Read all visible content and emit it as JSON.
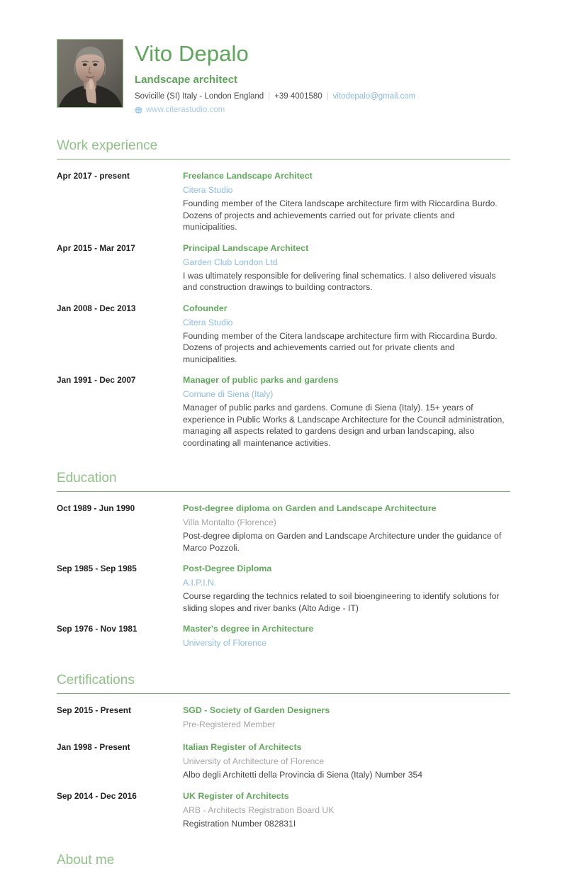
{
  "header": {
    "photo_alt": "profile-photo",
    "name": "Vito Depalo",
    "job_title": "Landscape architect",
    "location": "Sovicille (SI) Italy - London England",
    "phone": "+39 4001580",
    "email": "vitodepalo@gmail.com",
    "website": "www.citerastudio.com",
    "separator": "|",
    "colors": {
      "name_green": "#5da558",
      "heading_green": "#8fc287",
      "rule_green": "#74b06b",
      "link_blue": "#8cbbe8",
      "muted_gray": "#a6a6a6"
    }
  },
  "sections": [
    {
      "id": "work-experience",
      "title": "Work experience",
      "entries": [
        {
          "date": "Apr 2017 - present",
          "title": "Freelance Landscape Architect",
          "subtitle": "Citera Studio",
          "subtitle_style": "blue",
          "description": "Founding member of the Citera landscape architecture firm with Riccardina Burdo. Dozens of projects and achievements carried out for private clients and municipalities."
        },
        {
          "date": "Apr 2015 - Mar 2017",
          "title": "Principal Landscape Architect",
          "subtitle": "Garden Club London Ltd",
          "subtitle_style": "blue",
          "description": "I was  ultimately responsible for delivering final schematics. I also delivered visuals and construction drawings to building contractors."
        },
        {
          "date": "Jan 2008 - Dec 2013",
          "title": "Cofounder",
          "subtitle": "Citera Studio",
          "subtitle_style": "blue",
          "description": "Founding member of the Citera landscape architecture firm with Riccardina Burdo. Dozens of projects and achievements carried out for private clients and municipalities."
        },
        {
          "date": "Jan 1991 - Dec 2007",
          "title": "Manager of public parks and gardens",
          "subtitle": "Comune di Siena (Italy)",
          "subtitle_style": "blue",
          "description": "Manager of public parks and gardens. Comune di Siena (Italy). 15+ years of experience in Public Works & Landscape Architecture for the Council administration, managing all aspects related to gardens design and urban landscaping, also coordinating all maintenance activities."
        }
      ]
    },
    {
      "id": "education",
      "title": "Education",
      "entries": [
        {
          "date": "Oct 1989 - Jun 1990",
          "title": "Post-degree diploma on Garden and Landscape Architecture",
          "subtitle": "Villa Montalto (Florence)",
          "subtitle_style": "gray",
          "description": "Post-degree diploma on Garden and Landscape Architecture under the guidance of Marco Pozzoli."
        },
        {
          "date": "Sep 1985 - Sep 1985",
          "title": "Post-Degree Diploma",
          "subtitle": "A.I.P.I.N.",
          "subtitle_style": "blue",
          "description": "Course regarding the technics related to soil bioengineering to identify solutions for sliding slopes and river banks (Alto Adige - IT)"
        },
        {
          "date": "Sep 1976 - Nov 1981",
          "title": "Master's degree in Architecture",
          "subtitle": "University of Florence",
          "subtitle_style": "blue",
          "description": ""
        }
      ]
    },
    {
      "id": "certifications",
      "title": "Certifications",
      "entries": [
        {
          "date": "Sep 2015 - Present",
          "title": "SGD - Society of Garden Designers",
          "subtitle": "Pre-Registered Member",
          "subtitle_style": "gray",
          "description": ""
        },
        {
          "date": "Jan 1998 - Present",
          "title": "Italian Register of Architects",
          "subtitle": "University of Architecture of Florence",
          "subtitle_style": "gray",
          "description": "Albo degli Architetti della Provincia di Siena (Italy) Number 354"
        },
        {
          "date": "Sep 2014 - Dec 2016",
          "title": "UK Register of Architects",
          "subtitle": "ARB - Architects Registration Board UK",
          "subtitle_style": "gray",
          "description": "Registration Number 082831I"
        }
      ]
    }
  ],
  "about": {
    "title": "About me"
  }
}
